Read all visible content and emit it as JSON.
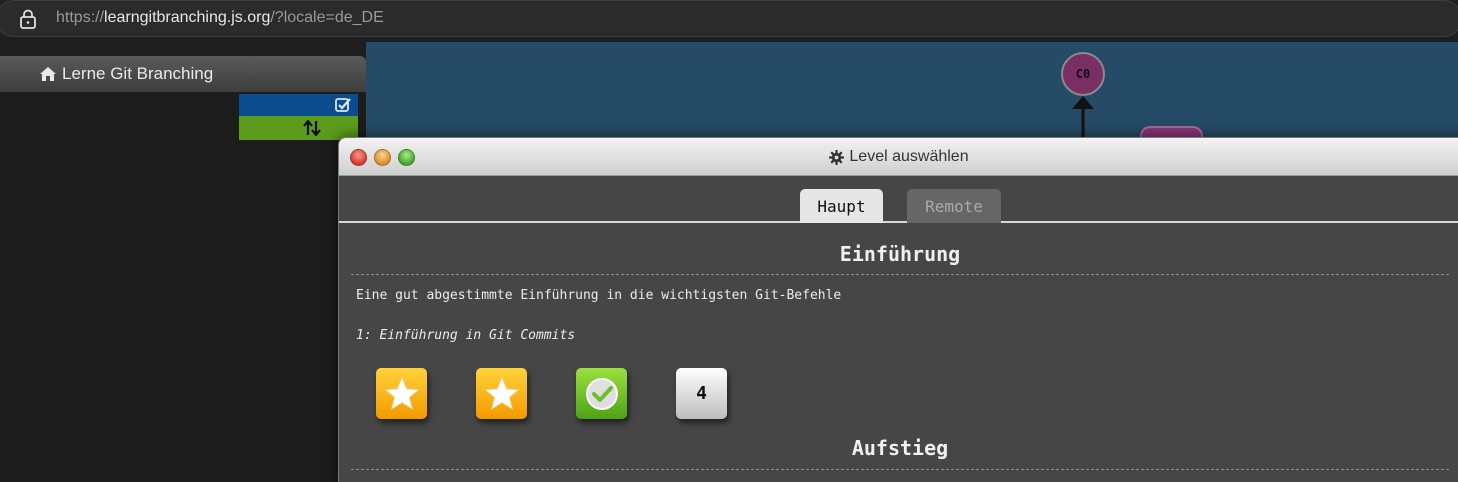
{
  "browser": {
    "url_prefix": "https://",
    "url_host": "learngitbranching.js.org",
    "url_path": "/?locale=de_DE"
  },
  "sidebar": {
    "title": "Lerne Git Branching"
  },
  "visualization": {
    "commit_label": "C0"
  },
  "modal": {
    "title": "Level auswählen",
    "tabs": [
      {
        "label": "Haupt",
        "active": true
      },
      {
        "label": "Remote",
        "active": false
      }
    ],
    "sections": [
      {
        "title": "Einführung",
        "description": "Eine gut abgestimmte Einführung in die wichtigsten Git-Befehle",
        "level_name": "1: Einführung in Git Commits",
        "levels": [
          {
            "state": "star",
            "icon": "star-icon"
          },
          {
            "state": "star",
            "icon": "star-icon"
          },
          {
            "state": "completed",
            "icon": "check-circle-icon"
          },
          {
            "state": "unsolved",
            "label": "4"
          }
        ]
      },
      {
        "title": "Aufstieg"
      }
    ]
  }
}
